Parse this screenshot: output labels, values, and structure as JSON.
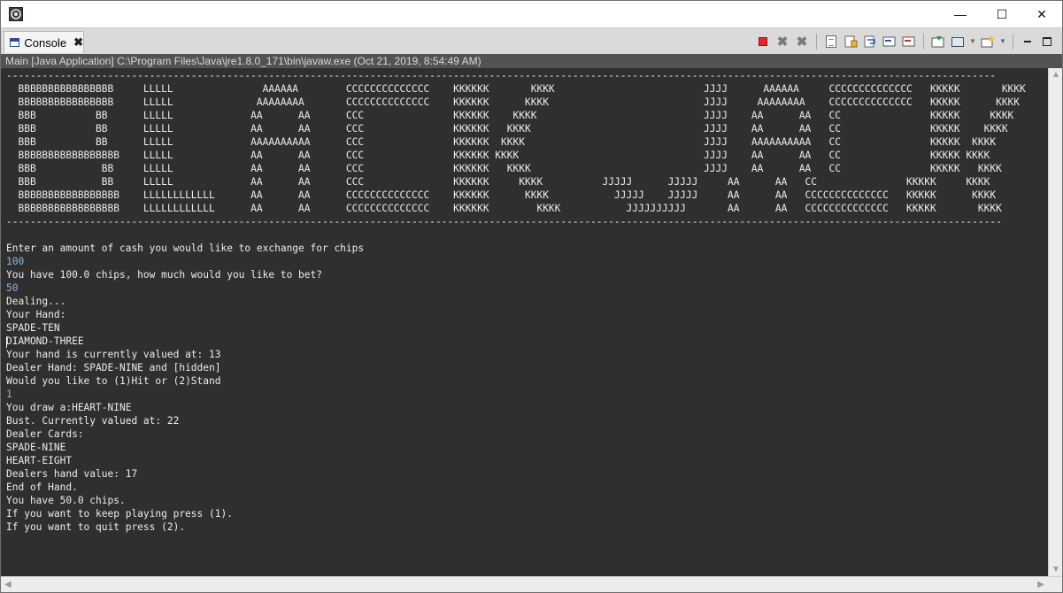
{
  "window": {
    "minimize_glyph": "—",
    "maximize_glyph": "☐",
    "close_glyph": "✕"
  },
  "tab": {
    "label": "Console",
    "close_glyph": "✖"
  },
  "toolbar": {
    "icons": [
      "terminate-icon",
      "remove-launch-icon",
      "remove-all-terminated-icon",
      "clear-console-icon",
      "scroll-lock-icon",
      "word-wrap-icon",
      "show-stdout-icon",
      "show-stderr-icon",
      "pin-console-icon",
      "display-console-icon",
      "open-console-icon",
      "minimize-view-icon",
      "maximize-view-icon"
    ]
  },
  "status": {
    "text": "Main [Java Application] C:\\Program Files\\Java\\jre1.8.0_171\\bin\\javaw.exe (Oct 21, 2019, 8:54:49 AM)"
  },
  "console": {
    "lines": [
      {
        "text": "----------------------------------------------------------------------------------------------------------------------------------------------------------------------",
        "kind": "out"
      },
      {
        "text": "  BBBBBBBBBBBBBBBB     LLLLL               AAAAAA        CCCCCCCCCCCCCC    KKKKKK       KKKK                         JJJJ      AAAAAA     CCCCCCCCCCCCCC   KKKKK       KKKK",
        "kind": "out"
      },
      {
        "text": "  BBBBBBBBBBBBBBBB     LLLLL              AAAAAAAA       CCCCCCCCCCCCCC    KKKKKK      KKKK                          JJJJ     AAAAAAAA    CCCCCCCCCCCCCC   KKKKK      KKKK",
        "kind": "out"
      },
      {
        "text": "  BBB          BB      LLLLL             AA      AA      CCC               KKKKKK    KKKK                            JJJJ    AA      AA   CC               KKKKK     KKKK",
        "kind": "out"
      },
      {
        "text": "  BBB          BB      LLLLL             AA      AA      CCC               KKKKKK   KKKK                             JJJJ    AA      AA   CC               KKKKK    KKKK",
        "kind": "out"
      },
      {
        "text": "  BBB          BB      LLLLL             AAAAAAAAAA      CCC               KKKKKK  KKKK                              JJJJ    AAAAAAAAAA   CC               KKKKK  KKKK",
        "kind": "out"
      },
      {
        "text": "  BBBBBBBBBBBBBBBBB    LLLLL             AA      AA      CCC               KKKKKK KKKK                               JJJJ    AA      AA   CC               KKKKK KKKK",
        "kind": "out"
      },
      {
        "text": "  BBB           BB     LLLLL             AA      AA      CCC               KKKKKK   KKKK                             JJJJ    AA      AA   CC               KKKKK   KKKK",
        "kind": "out"
      },
      {
        "text": "  BBB           BB     LLLLL             AA      AA      CCC               KKKKKK     KKKK          JJJJJ      JJJJJ     AA      AA   CC               KKKKK     KKKK",
        "kind": "out"
      },
      {
        "text": "  BBBBBBBBBBBBBBBBB    LLLLLLLLLLLL      AA      AA      CCCCCCCCCCCCCC    KKKKKK      KKKK           JJJJJ    JJJJJ     AA      AA   CCCCCCCCCCCCCC   KKKKK      KKKK",
        "kind": "out"
      },
      {
        "text": "  BBBBBBBBBBBBBBBBB    LLLLLLLLLLLL      AA      AA      CCCCCCCCCCCCCC    KKKKKK        KKKK           JJJJJJJJJJ       AA      AA   CCCCCCCCCCCCCC   KKKKK       KKKK",
        "kind": "out"
      },
      {
        "text": "-----------------------------------------------------------------------------------------------------------------------------------------------------------------------",
        "kind": "out"
      },
      {
        "text": "",
        "kind": "out"
      },
      {
        "text": "Enter an amount of cash you would like to exchange for chips",
        "kind": "out"
      },
      {
        "text": "100",
        "kind": "input"
      },
      {
        "text": "You have 100.0 chips, how much would you like to bet?",
        "kind": "out"
      },
      {
        "text": "50",
        "kind": "input"
      },
      {
        "text": "Dealing...",
        "kind": "out"
      },
      {
        "text": "Your Hand:",
        "kind": "out"
      },
      {
        "text": "SPADE-TEN",
        "kind": "out"
      },
      {
        "text": "DIAMOND-THREE",
        "kind": "out"
      },
      {
        "text": "Your hand is currently valued at: 13",
        "kind": "out"
      },
      {
        "text": "Dealer Hand: SPADE-NINE and [hidden]",
        "kind": "out"
      },
      {
        "text": "Would you like to (1)Hit or (2)Stand",
        "kind": "out"
      },
      {
        "text": "1",
        "kind": "input"
      },
      {
        "text": "You draw a:HEART-NINE",
        "kind": "out"
      },
      {
        "text": "Bust. Currently valued at: 22",
        "kind": "out"
      },
      {
        "text": "Dealer Cards:",
        "kind": "out"
      },
      {
        "text": "SPADE-NINE",
        "kind": "out"
      },
      {
        "text": "HEART-EIGHT",
        "kind": "out"
      },
      {
        "text": "Dealers hand value: 17",
        "kind": "out"
      },
      {
        "text": "End of Hand.",
        "kind": "out"
      },
      {
        "text": "You have 50.0 chips.",
        "kind": "out"
      },
      {
        "text": "If you want to keep playing press (1).",
        "kind": "out"
      },
      {
        "text": "If you want to quit press (2).",
        "kind": "out"
      }
    ]
  }
}
